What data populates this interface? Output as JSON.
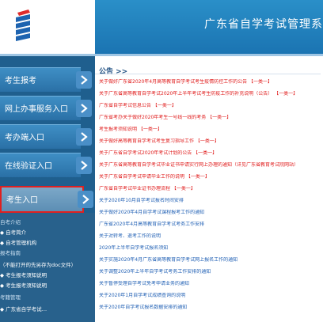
{
  "header": {
    "title": "广东省自学考试管理系统"
  },
  "sidebar": {
    "menu": [
      {
        "label": "考生报考",
        "active": false
      },
      {
        "label": "网上办事服务入口",
        "active": false
      },
      {
        "label": "考办端入口",
        "active": false
      },
      {
        "label": "在线验证入口",
        "active": false
      },
      {
        "label": "考生入口",
        "active": true
      }
    ],
    "links": [
      {
        "text": "自考介绍",
        "type": "head"
      },
      {
        "text": "◆ 自考简介",
        "type": "item"
      },
      {
        "text": "◆ 自考管理机构",
        "type": "item"
      },
      {
        "text": "报考指南",
        "type": "head"
      },
      {
        "text": "（不能打开的先另存为doc文件）",
        "type": "item"
      },
      {
        "text": "◆ 考生报考须知说明",
        "type": "item"
      },
      {
        "text": "◆ 考生报考须知说明",
        "type": "item"
      },
      {
        "text": "考籍管理",
        "type": "head"
      },
      {
        "text": "◆ 广东省自学考试…",
        "type": "item"
      }
    ]
  },
  "notices": {
    "title": "公告 >>",
    "items": [
      {
        "text": "关于做好广东省2020年4月高等教育自学考试考生疫情防控工作的公告 【一类一】",
        "color": "red"
      },
      {
        "text": "关于广东省高等教育自学考试2020年上半年考试考生防疫工作的补充说明（公告） 【一类一】",
        "color": "red"
      },
      {
        "text": "广东省自学考试信息公告 【一类一】",
        "color": "red"
      },
      {
        "text": "广东省考办关于做好2020年考生一号线一线的考务 【一类一】",
        "color": "red"
      },
      {
        "text": "考生报考须知说明 【一类一】",
        "color": "red"
      },
      {
        "text": "关于做好高等教育自学考试考生复习指导工作 【一类一】",
        "color": "red"
      },
      {
        "text": "关于广东省自学考试2020年考试计划的公告 【一类一】",
        "color": "red"
      },
      {
        "text": "关于广东省高等教育自学考试毕业证书申请实行网上办理的通知（详见广东省教育考试院网站） ",
        "color": "red"
      },
      {
        "text": "关于广东省自学考试申请毕业工作的说明 【一类一】",
        "color": "red"
      },
      {
        "text": "广东省自学考试毕业证书办理流程 【一类一】",
        "color": "red"
      },
      {
        "text": "关于2020年10月自学考试报名时间安排",
        "color": "blue"
      },
      {
        "text": "关于做好2020年4月自学考试课程报考工作的通知",
        "color": "blue"
      },
      {
        "text": "广东省2020年4月高等教育自学考试考务工作安排",
        "color": "blue"
      },
      {
        "text": "关于对转考、退考工作的说明",
        "color": "blue"
      },
      {
        "text": "2020年上半年自学考试报名须知",
        "color": "blue"
      },
      {
        "text": "关于实施2020年4月广东省高等教育自学考试网上报名工作的通知",
        "color": "blue"
      },
      {
        "text": "关于调整2020年上半年自学考试考务工作安排的通知",
        "color": "blue"
      },
      {
        "text": "关于暂停受理自学考试免考申请业务的通知",
        "color": "blue"
      },
      {
        "text": "关于2020年1月自学考试成绩查询的说明",
        "color": "blue"
      },
      {
        "text": "关于2020年自学考试报名数据安排的通知",
        "color": "blue"
      }
    ]
  },
  "colors": {
    "header_blue": "#1b74b2",
    "sidebar_blue": "#1f5f8e",
    "notice_red": "#e01b1b",
    "notice_blue": "#1f5fb4"
  }
}
